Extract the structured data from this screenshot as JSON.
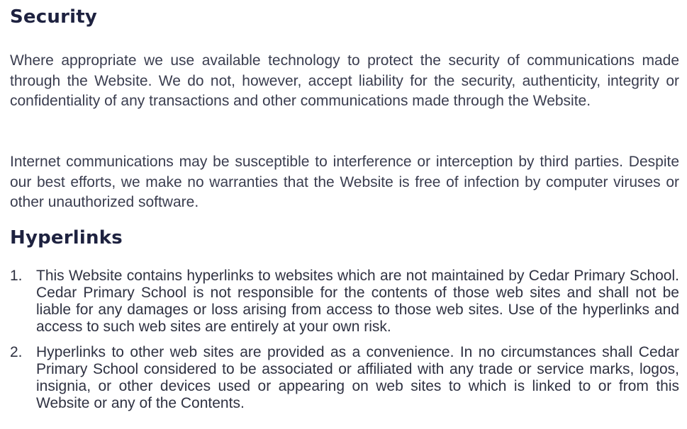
{
  "security": {
    "heading": "Security",
    "paragraphs": [
      "Where appropriate we use available technology to protect the security of communications made through the Website. We do not, however, accept liability for the security, authenticity, integrity or confidentiality of any transactions and other communications made through the Website.",
      "Internet communications may be susceptible to interference or interception by third parties. Despite our best efforts, we make no warranties that the Website is free of infection by computer viruses or other unauthorized software."
    ]
  },
  "hyperlinks": {
    "heading": "Hyperlinks",
    "items": [
      {
        "number": "1.",
        "text": "This Website contains hyperlinks to websites which are not maintained by Cedar Primary School. Cedar Primary School is not responsible for the contents of those web sites and shall not be liable for any damages or loss arising from access to those web sites. Use of the hyperlinks and access to such web sites are entirely at your own risk."
      },
      {
        "number": "2.",
        "text": "Hyperlinks to other web sites are provided as a convenience. In no circumstances shall Cedar Primary School considered to be associated or affiliated with any trade or service marks, logos, insignia, or other devices used or appearing on web sites to which is linked to or from this Website or any of the Contents."
      }
    ]
  }
}
